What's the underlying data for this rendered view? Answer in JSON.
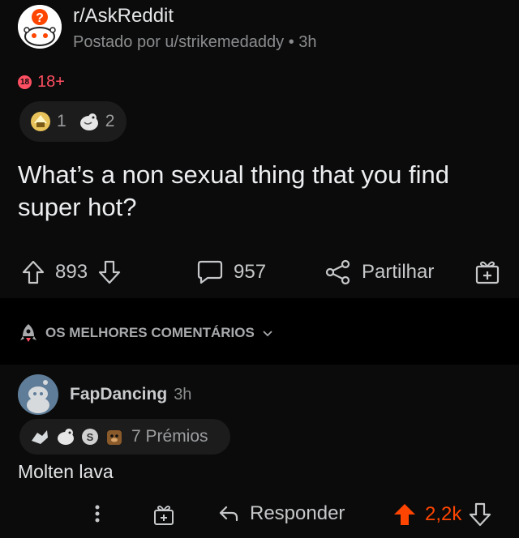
{
  "post": {
    "subreddit": "r/AskReddit",
    "posted_by": "Postado por u/strikemedaddy • 3h",
    "nsfw_badge": "18",
    "nsfw_label": "18+",
    "awards": [
      {
        "icon": "gold-award-icon",
        "count": "1"
      },
      {
        "icon": "wholesome-award-icon",
        "count": "2"
      }
    ],
    "title": "What’s a non sexual thing that you find super hot?",
    "upvotes": "893",
    "comments": "957",
    "share_label": "Partilhar"
  },
  "sort": {
    "label": "OS MELHORES COMENTÁRIOS"
  },
  "comment": {
    "username": "FapDancing",
    "time": "3h",
    "awards_label": "7 Prémios",
    "body": "Molten lava",
    "reply_label": "Responder",
    "score": "2,2k"
  },
  "colors": {
    "upvoted": "#ff4500",
    "nsfw": "#ff4f62"
  }
}
